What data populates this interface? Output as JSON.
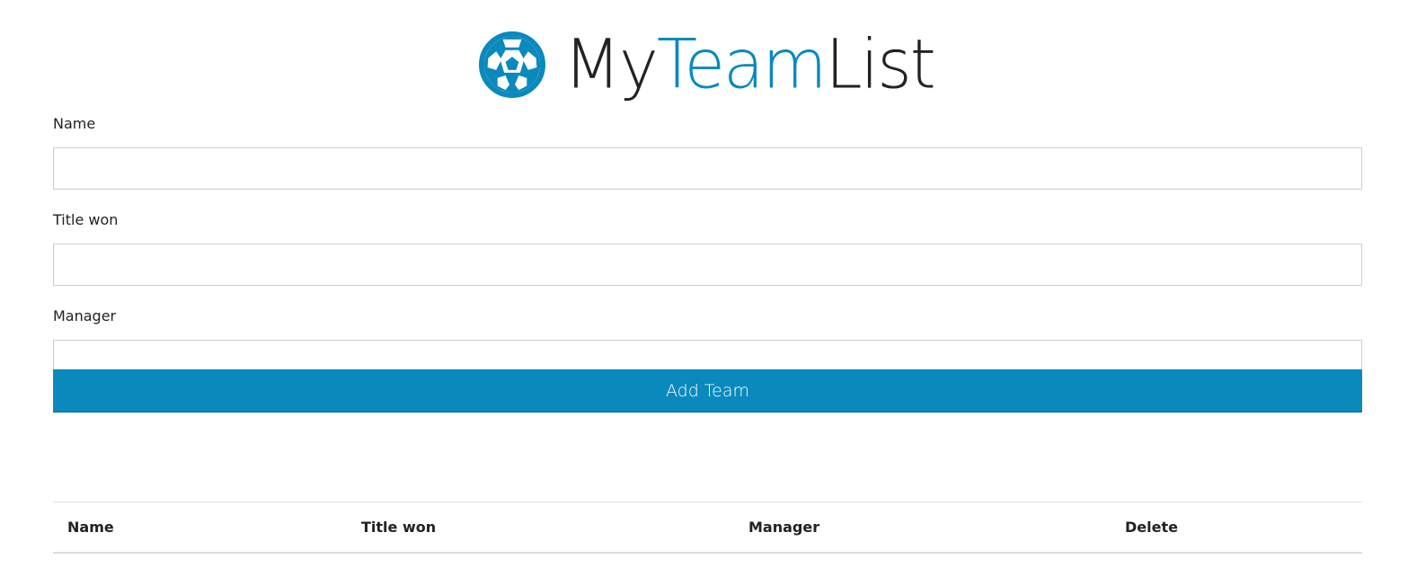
{
  "app": {
    "logo_part1": "My",
    "logo_part2": "Team",
    "logo_part3": "List",
    "logo_icon": "soccer-ball-icon"
  },
  "colors": {
    "accent": "#0a89bd",
    "text": "#222222"
  },
  "form": {
    "name_label": "Name",
    "name_value": "",
    "title_label": "Title won",
    "title_value": "",
    "manager_label": "Manager",
    "manager_value": "",
    "submit_label": "Add Team"
  },
  "table": {
    "columns": [
      "Name",
      "Title won",
      "Manager",
      "Delete"
    ],
    "rows": []
  }
}
